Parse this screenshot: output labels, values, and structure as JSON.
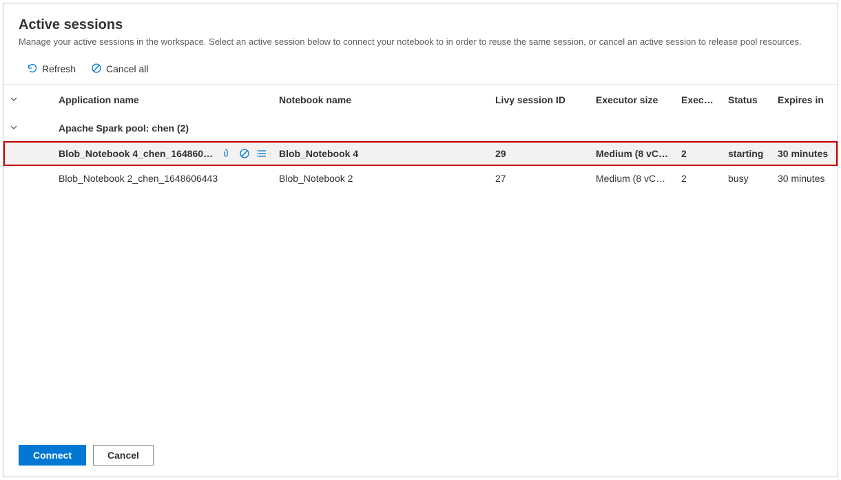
{
  "title": "Active sessions",
  "subtitle": "Manage your active sessions in the workspace. Select an active session below to connect your notebook to in order to reuse the same session, or cancel an active session to release pool resources.",
  "toolbar": {
    "refresh": "Refresh",
    "cancel_all": "Cancel all"
  },
  "columns": {
    "app_name": "Application name",
    "notebook_name": "Notebook name",
    "livy_id": "Livy session ID",
    "executor_size": "Executor size",
    "executors": "Execut...",
    "status": "Status",
    "expires_in": "Expires in"
  },
  "group": {
    "label": "Apache Spark pool: chen (2)"
  },
  "rows": [
    {
      "app_name": "Blob_Notebook 4_chen_16486065...",
      "notebook_name": "Blob_Notebook 4",
      "livy_id": "29",
      "executor_size": "Medium (8 vCor...",
      "executors": "2",
      "status": "starting",
      "expires_in": "30 minutes",
      "selected": true
    },
    {
      "app_name": "Blob_Notebook 2_chen_1648606443",
      "notebook_name": "Blob_Notebook 2",
      "livy_id": "27",
      "executor_size": "Medium (8 vCor...",
      "executors": "2",
      "status": "busy",
      "expires_in": "30 minutes",
      "selected": false
    }
  ],
  "footer": {
    "connect": "Connect",
    "cancel": "Cancel"
  },
  "icons": {
    "attach": "attach-icon",
    "cancel_session": "cancel-session-icon",
    "details": "details-icon"
  }
}
